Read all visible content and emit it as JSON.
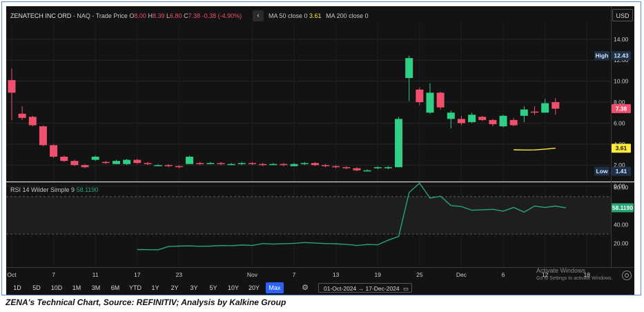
{
  "header": {
    "symbol": "ZENATECH INC ORD",
    "exchange": "- NAQ - Trade Price",
    "o_label": "O",
    "o_value": "8.00",
    "h_label": "H",
    "h_value": "8.39",
    "l_label": "L",
    "l_value": "6.80",
    "c_label": "C",
    "c_value": "7.38",
    "change": "-0.38 (-4.90%)",
    "ma50_label": "MA 50 close 0",
    "ma50_value": "3.61",
    "ma200_label": "MA 200 close 0",
    "currency": "USD"
  },
  "colors": {
    "up": "#2fcf86",
    "down": "#f0506e",
    "ma50": "#ffeb3b",
    "rsi": "#26a672",
    "background": "#131313",
    "text": "#d8d8d8"
  },
  "price_labels": {
    "high_tag": "High",
    "high_value": "12.43",
    "low_tag": "Low",
    "low_value": "1.41",
    "last_value": "7.38",
    "ma_value": "3.61"
  },
  "rsi": {
    "title": "RSI 14 Wilder Simple 9",
    "value": "58.1190",
    "yticks": [
      "80.00",
      "60.00",
      "40.00",
      "20.00"
    ]
  },
  "x_axis_labels": [
    "Oct",
    "7",
    "11",
    "17",
    "23",
    "Nov",
    "7",
    "13",
    "19",
    "25",
    "Dec",
    "6",
    "12",
    "18"
  ],
  "toolbar": {
    "ranges": [
      "1D",
      "5D",
      "10D",
      "1M",
      "3M",
      "6M",
      "YTD",
      "1Y",
      "2Y",
      "3Y",
      "5Y",
      "10Y",
      "20Y",
      "Max"
    ],
    "active": "Max",
    "date_from": "01-Oct-2024",
    "date_to": "17-Dec-2024",
    "date_arrow": "→"
  },
  "watermark": {
    "line1": "Activate Windows",
    "line2": "Go to Settings to activate Windows."
  },
  "caption": "ZENA's Technical Chart, Source: REFINITIV; Analysis by Kalkine Group",
  "chart_data": [
    {
      "type": "candlestick",
      "title": "ZENATECH INC ORD - NAQ - Trade Price",
      "y_ticks": [
        0,
        2,
        4,
        6,
        8,
        10,
        12,
        14
      ],
      "ylim": [
        -0.5,
        15
      ],
      "currency": "USD",
      "grid": true,
      "candles": [
        {
          "date": "2024-10-01",
          "open": 10.1,
          "high": 11.2,
          "low": 6.3,
          "close": 8.9
        },
        {
          "date": "2024-10-02",
          "open": 6.9,
          "high": 7.6,
          "low": 6.3,
          "close": 6.5
        },
        {
          "date": "2024-10-03",
          "open": 6.6,
          "high": 6.7,
          "low": 5.7,
          "close": 5.8
        },
        {
          "date": "2024-10-04",
          "open": 5.7,
          "high": 5.8,
          "low": 3.8,
          "close": 3.9
        },
        {
          "date": "2024-10-07",
          "open": 3.9,
          "high": 4.0,
          "low": 2.7,
          "close": 2.8
        },
        {
          "date": "2024-10-08",
          "open": 2.8,
          "high": 2.9,
          "low": 2.3,
          "close": 2.4
        },
        {
          "date": "2024-10-09",
          "open": 2.4,
          "high": 2.5,
          "low": 1.9,
          "close": 2.0
        },
        {
          "date": "2024-10-10",
          "open": 2.0,
          "high": 2.1,
          "low": 1.7,
          "close": 1.8
        },
        {
          "date": "2024-10-11",
          "open": 2.5,
          "high": 2.9,
          "low": 2.4,
          "close": 2.8
        },
        {
          "date": "2024-10-14",
          "open": 2.3,
          "high": 2.4,
          "low": 2.1,
          "close": 2.2
        },
        {
          "date": "2024-10-15",
          "open": 2.1,
          "high": 2.5,
          "low": 2.1,
          "close": 2.4
        },
        {
          "date": "2024-10-16",
          "open": 2.1,
          "high": 2.6,
          "low": 2.0,
          "close": 2.5
        },
        {
          "date": "2024-10-17",
          "open": 2.5,
          "high": 2.6,
          "low": 2.1,
          "close": 2.2
        },
        {
          "date": "2024-10-18",
          "open": 2.2,
          "high": 2.3,
          "low": 2.0,
          "close": 2.1
        },
        {
          "date": "2024-10-21",
          "open": 2.0,
          "high": 2.1,
          "low": 1.9,
          "close": 2.0
        },
        {
          "date": "2024-10-22",
          "open": 2.0,
          "high": 2.1,
          "low": 1.8,
          "close": 1.9
        },
        {
          "date": "2024-10-23",
          "open": 1.9,
          "high": 2.0,
          "low": 1.7,
          "close": 1.8
        },
        {
          "date": "2024-10-24",
          "open": 2.1,
          "high": 2.9,
          "low": 2.1,
          "close": 2.8
        },
        {
          "date": "2024-10-25",
          "open": 2.2,
          "high": 2.3,
          "low": 2.0,
          "close": 2.1
        },
        {
          "date": "2024-10-28",
          "open": 2.1,
          "high": 2.3,
          "low": 2.1,
          "close": 2.2
        },
        {
          "date": "2024-10-29",
          "open": 2.2,
          "high": 2.3,
          "low": 2.0,
          "close": 2.1
        },
        {
          "date": "2024-10-30",
          "open": 2.1,
          "high": 2.2,
          "low": 2.0,
          "close": 2.1
        },
        {
          "date": "2024-10-31",
          "open": 2.1,
          "high": 2.3,
          "low": 2.0,
          "close": 2.2
        },
        {
          "date": "2024-11-01",
          "open": 2.2,
          "high": 2.3,
          "low": 2.0,
          "close": 2.1
        },
        {
          "date": "2024-11-04",
          "open": 2.1,
          "high": 2.2,
          "low": 1.9,
          "close": 2.0
        },
        {
          "date": "2024-11-05",
          "open": 2.0,
          "high": 2.2,
          "low": 2.0,
          "close": 2.1
        },
        {
          "date": "2024-11-06",
          "open": 2.1,
          "high": 2.2,
          "low": 1.9,
          "close": 2.0
        },
        {
          "date": "2024-11-07",
          "open": 1.9,
          "high": 2.2,
          "low": 1.9,
          "close": 2.1
        },
        {
          "date": "2024-11-08",
          "open": 2.1,
          "high": 2.3,
          "low": 2.0,
          "close": 2.2
        },
        {
          "date": "2024-11-11",
          "open": 2.2,
          "high": 2.3,
          "low": 1.9,
          "close": 2.0
        },
        {
          "date": "2024-11-12",
          "open": 2.0,
          "high": 2.1,
          "low": 1.8,
          "close": 1.9
        },
        {
          "date": "2024-11-13",
          "open": 1.9,
          "high": 2.0,
          "low": 1.7,
          "close": 1.8
        },
        {
          "date": "2024-11-14",
          "open": 1.8,
          "high": 1.9,
          "low": 1.6,
          "close": 1.7
        },
        {
          "date": "2024-11-15",
          "open": 1.7,
          "high": 1.8,
          "low": 1.4,
          "close": 1.5
        },
        {
          "date": "2024-11-18",
          "open": 1.5,
          "high": 1.6,
          "low": 1.4,
          "close": 1.5
        },
        {
          "date": "2024-11-19",
          "open": 1.7,
          "high": 1.9,
          "low": 1.6,
          "close": 1.8
        },
        {
          "date": "2024-11-20",
          "open": 1.7,
          "high": 1.9,
          "low": 1.6,
          "close": 1.8
        },
        {
          "date": "2024-11-21",
          "open": 1.8,
          "high": 6.6,
          "low": 1.8,
          "close": 6.4
        },
        {
          "date": "2024-11-22",
          "open": 10.3,
          "high": 12.43,
          "low": 8.1,
          "close": 12.2
        },
        {
          "date": "2024-11-25",
          "open": 9.2,
          "high": 9.4,
          "low": 7.7,
          "close": 8.0
        },
        {
          "date": "2024-11-26",
          "open": 7.0,
          "high": 9.8,
          "low": 6.9,
          "close": 8.9
        },
        {
          "date": "2024-11-27",
          "open": 8.9,
          "high": 9.0,
          "low": 7.3,
          "close": 7.5
        },
        {
          "date": "2024-11-29",
          "open": 6.4,
          "high": 7.2,
          "low": 5.5,
          "close": 7.0
        },
        {
          "date": "2024-12-02",
          "open": 6.4,
          "high": 6.7,
          "low": 5.8,
          "close": 6.0
        },
        {
          "date": "2024-12-03",
          "open": 6.1,
          "high": 7.0,
          "low": 6.0,
          "close": 6.8
        },
        {
          "date": "2024-12-04",
          "open": 6.6,
          "high": 6.7,
          "low": 6.2,
          "close": 6.3
        },
        {
          "date": "2024-12-05",
          "open": 6.3,
          "high": 6.4,
          "low": 5.7,
          "close": 5.9
        },
        {
          "date": "2024-12-06",
          "open": 5.7,
          "high": 6.8,
          "low": 5.6,
          "close": 6.7
        },
        {
          "date": "2024-12-09",
          "open": 6.3,
          "high": 6.5,
          "low": 5.7,
          "close": 5.8
        },
        {
          "date": "2024-12-10",
          "open": 6.7,
          "high": 7.6,
          "low": 6.1,
          "close": 7.3
        },
        {
          "date": "2024-12-11",
          "open": 7.1,
          "high": 7.6,
          "low": 6.8,
          "close": 7.0
        },
        {
          "date": "2024-12-12",
          "open": 7.0,
          "high": 8.3,
          "low": 7.0,
          "close": 7.9
        },
        {
          "date": "2024-12-13",
          "open": 8.0,
          "high": 8.39,
          "low": 6.8,
          "close": 7.38
        }
      ],
      "ma50": {
        "name": "MA 50 close 0",
        "points": [
          [
            "2024-12-09",
            3.46
          ],
          [
            "2024-12-10",
            3.44
          ],
          [
            "2024-12-11",
            3.45
          ],
          [
            "2024-12-12",
            3.52
          ],
          [
            "2024-12-13",
            3.61
          ]
        ]
      }
    },
    {
      "type": "line",
      "title": "RSI 14 Wilder Simple 9",
      "ylim": [
        0,
        100
      ],
      "y_ticks": [
        80,
        60,
        40,
        20
      ],
      "band": [
        30,
        70
      ],
      "series": [
        {
          "name": "RSI 14 Wilder Simple 9",
          "points": [
            [
              "2024-10-17",
              13.5
            ],
            [
              "2024-10-18",
              13.4
            ],
            [
              "2024-10-21",
              13.2
            ],
            [
              "2024-10-22",
              16.8
            ],
            [
              "2024-10-23",
              17.2
            ],
            [
              "2024-10-24",
              17.4
            ],
            [
              "2024-10-25",
              17.0
            ],
            [
              "2024-10-28",
              17.2
            ],
            [
              "2024-10-29",
              17.8
            ],
            [
              "2024-10-30",
              17.6
            ],
            [
              "2024-10-31",
              18.3
            ],
            [
              "2024-11-01",
              17.9
            ],
            [
              "2024-11-04",
              19.8
            ],
            [
              "2024-11-05",
              19.4
            ],
            [
              "2024-11-06",
              19.7
            ],
            [
              "2024-11-07",
              20.1
            ],
            [
              "2024-11-08",
              21.0
            ],
            [
              "2024-11-11",
              20.5
            ],
            [
              "2024-11-12",
              19.9
            ],
            [
              "2024-11-13",
              19.6
            ],
            [
              "2024-11-14",
              19.0
            ],
            [
              "2024-11-15",
              17.8
            ],
            [
              "2024-11-18",
              18.9
            ],
            [
              "2024-11-19",
              18.6
            ],
            [
              "2024-11-20",
              23.5
            ],
            [
              "2024-11-21",
              27.5
            ],
            [
              "2024-11-22",
              74.5
            ],
            [
              "2024-11-25",
              84.5
            ],
            [
              "2024-11-26",
              68.5
            ],
            [
              "2024-11-27",
              70.5
            ],
            [
              "2024-11-29",
              60.5
            ],
            [
              "2024-12-02",
              59.5
            ],
            [
              "2024-12-03",
              55.5
            ],
            [
              "2024-12-04",
              56.0
            ],
            [
              "2024-12-05",
              56.5
            ],
            [
              "2024-12-06",
              54.5
            ],
            [
              "2024-12-09",
              58.5
            ],
            [
              "2024-12-10",
              53.5
            ],
            [
              "2024-12-11",
              60.0
            ],
            [
              "2024-12-12",
              58.5
            ],
            [
              "2024-12-13",
              60.0
            ],
            [
              "2024-12-16",
              58.1
            ]
          ]
        }
      ]
    }
  ]
}
